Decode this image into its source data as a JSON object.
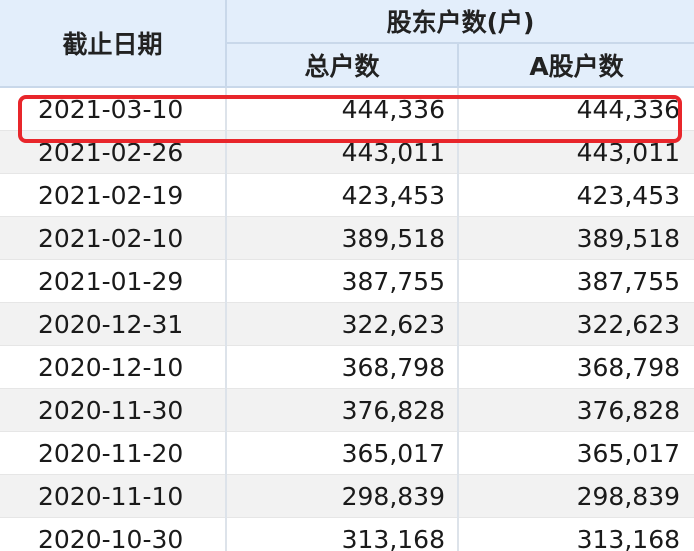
{
  "header": {
    "date_col": "截止日期",
    "group": "股东户数(户)",
    "total_col": "总户数",
    "a_col": "A股户数"
  },
  "rows": [
    {
      "date": "2021-03-10",
      "total": "444,336",
      "a_shares": "444,336"
    },
    {
      "date": "2021-02-26",
      "total": "443,011",
      "a_shares": "443,011"
    },
    {
      "date": "2021-02-19",
      "total": "423,453",
      "a_shares": "423,453"
    },
    {
      "date": "2021-02-10",
      "total": "389,518",
      "a_shares": "389,518"
    },
    {
      "date": "2021-01-29",
      "total": "387,755",
      "a_shares": "387,755"
    },
    {
      "date": "2020-12-31",
      "total": "322,623",
      "a_shares": "322,623"
    },
    {
      "date": "2020-12-10",
      "total": "368,798",
      "a_shares": "368,798"
    },
    {
      "date": "2020-11-30",
      "total": "376,828",
      "a_shares": "376,828"
    },
    {
      "date": "2020-11-20",
      "total": "365,017",
      "a_shares": "365,017"
    },
    {
      "date": "2020-11-10",
      "total": "298,839",
      "a_shares": "298,839"
    },
    {
      "date": "2020-10-30",
      "total": "313,168",
      "a_shares": "313,168"
    }
  ],
  "colors": {
    "header_bg": "#e3eefb",
    "stripe_bg": "#f2f2f2",
    "highlight": "#e8262b"
  }
}
